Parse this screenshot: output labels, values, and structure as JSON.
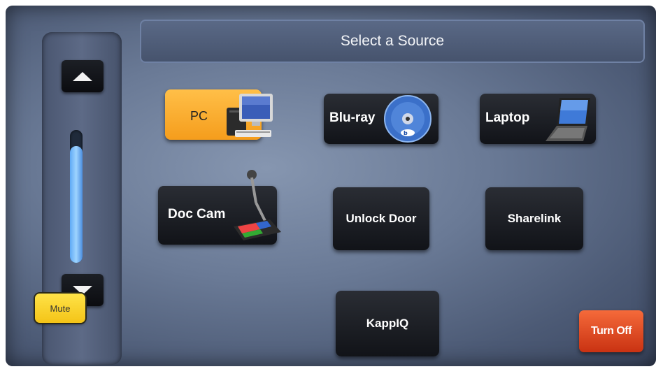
{
  "header": {
    "title": "Select a Source"
  },
  "volume": {
    "up_icon": "arrow-up-icon",
    "down_icon": "arrow-down-icon",
    "level": 0.88,
    "mute_label": "Mute"
  },
  "sources": {
    "pc": {
      "label": "PC",
      "icon": "desktop-pc-icon"
    },
    "bluray": {
      "label": "Blu-ray",
      "icon": "bluray-disc-icon"
    },
    "laptop": {
      "label": "Laptop",
      "icon": "laptop-icon"
    },
    "doccam": {
      "label": "Doc Cam",
      "icon": "document-camera-icon"
    },
    "unlock": {
      "label": "Unlock Door"
    },
    "sharelink": {
      "label": "Sharelink"
    },
    "kappiq": {
      "label": "KappIQ"
    }
  },
  "power": {
    "turn_off_label": "Turn Off"
  },
  "colors": {
    "selected_source": "#f5a623",
    "mute": "#f4c417",
    "turn_off": "#d9411d",
    "volume_fill": "#6fb6ff"
  }
}
